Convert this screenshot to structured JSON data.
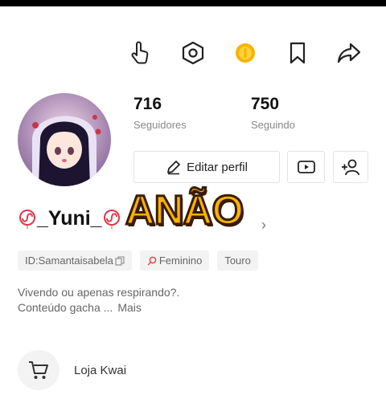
{
  "header": {
    "icons": [
      "hand-pointer-icon",
      "hexagon-settings-icon",
      "gold-coin-icon",
      "bookmark-icon",
      "share-icon"
    ]
  },
  "profile": {
    "followers": "716",
    "followers_label": "Seguidores",
    "following": "750",
    "following_label": "Seguindo",
    "edit_label": "Editar perfil",
    "username": "_Yuni_",
    "id_tag": "ID:Samantaisabela",
    "gender_tag": "Feminino",
    "zodiac_tag": "Touro",
    "bio_line1": "Vivendo ou apenas respirando?.",
    "bio_line2": "Conteúdo gacha ...",
    "bio_more": "Mais"
  },
  "overlay": {
    "text": "ANÃO"
  },
  "shop": {
    "label": "Loja Kwai"
  },
  "colors": {
    "accent_gender": "#e24a4a",
    "coin": "#f6b400",
    "overlay_text": "#f6b400"
  }
}
